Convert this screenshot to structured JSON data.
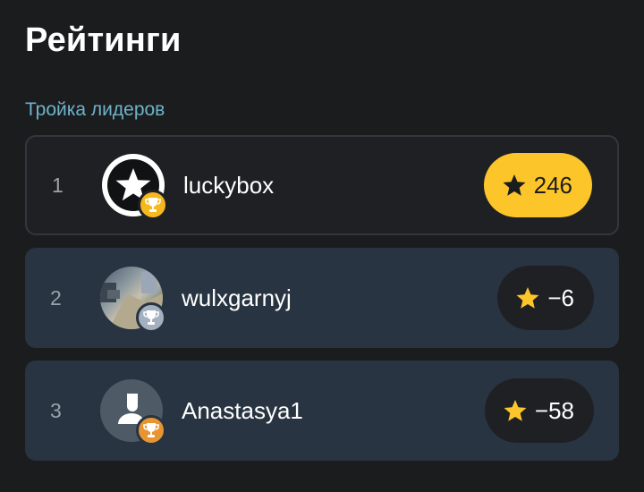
{
  "page": {
    "title": "Рейтинги"
  },
  "section": {
    "title": "Тройка лидеров"
  },
  "leaders": [
    {
      "rank": "1",
      "username": "luckybox",
      "score": "246",
      "trophy": "gold-trophy-icon",
      "avatar": "star-avatar"
    },
    {
      "rank": "2",
      "username": "wulxgarnyj",
      "score": "−6",
      "trophy": "silver-trophy-icon",
      "avatar": "photo-avatar"
    },
    {
      "rank": "3",
      "username": "Anastasya1",
      "score": "−58",
      "trophy": "bronze-trophy-icon",
      "avatar": "default-user-avatar"
    }
  ],
  "colors": {
    "background": "#1b1c1e",
    "accent_gold": "#fcc52a",
    "row_bg": "#283441",
    "section_title": "#6fb3c9",
    "trophy_gold": "#f5b81e",
    "trophy_silver": "#a4b0bf",
    "trophy_bronze": "#e89432"
  }
}
